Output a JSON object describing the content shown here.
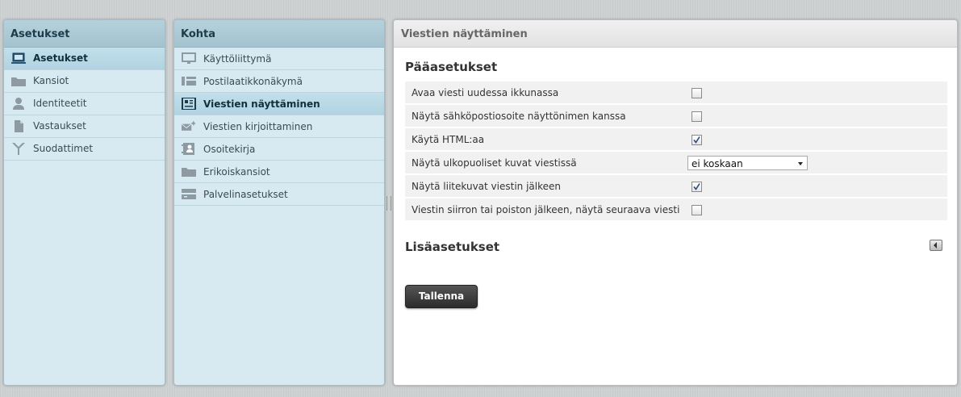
{
  "sections": {
    "title": "Asetukset",
    "items": [
      {
        "label": "Asetukset",
        "icon": "monitor-icon",
        "selected": true
      },
      {
        "label": "Kansiot",
        "icon": "folder-icon"
      },
      {
        "label": "Identiteetit",
        "icon": "person-icon"
      },
      {
        "label": "Vastaukset",
        "icon": "document-icon"
      },
      {
        "label": "Suodattimet",
        "icon": "filter-icon"
      }
    ]
  },
  "items": {
    "title": "Kohta",
    "list": [
      {
        "label": "Käyttöliittymä",
        "icon": "display-icon"
      },
      {
        "label": "Postilaatikkonäkymä",
        "icon": "mailbox-view-icon"
      },
      {
        "label": "Viestien näyttäminen",
        "icon": "message-view-icon",
        "selected": true
      },
      {
        "label": "Viestien kirjoittaminen",
        "icon": "compose-icon"
      },
      {
        "label": "Osoitekirja",
        "icon": "addressbook-icon"
      },
      {
        "label": "Erikoiskansiot",
        "icon": "special-folder-icon"
      },
      {
        "label": "Palvelinasetukset",
        "icon": "server-icon"
      }
    ]
  },
  "content": {
    "title": "Viestien näyttäminen",
    "main_section": "Pääasetukset",
    "options": [
      {
        "label": "Avaa viesti uudessa ikkunassa",
        "type": "checkbox",
        "checked": false
      },
      {
        "label": "Näytä sähköpostiosoite näyttönimen kanssa",
        "type": "checkbox",
        "checked": false
      },
      {
        "label": "Käytä HTML:aa",
        "type": "checkbox",
        "checked": true
      },
      {
        "label": "Näytä ulkopuoliset kuvat viestissä",
        "type": "select",
        "value": "ei koskaan"
      },
      {
        "label": "Näytä liitekuvat viestin jälkeen",
        "type": "checkbox",
        "checked": true
      },
      {
        "label": "Viestin siirron tai poiston jälkeen, näytä seuraava viesti",
        "type": "checkbox",
        "checked": false
      }
    ],
    "advanced_section": "Lisäasetukset",
    "save_label": "Tallenna"
  }
}
